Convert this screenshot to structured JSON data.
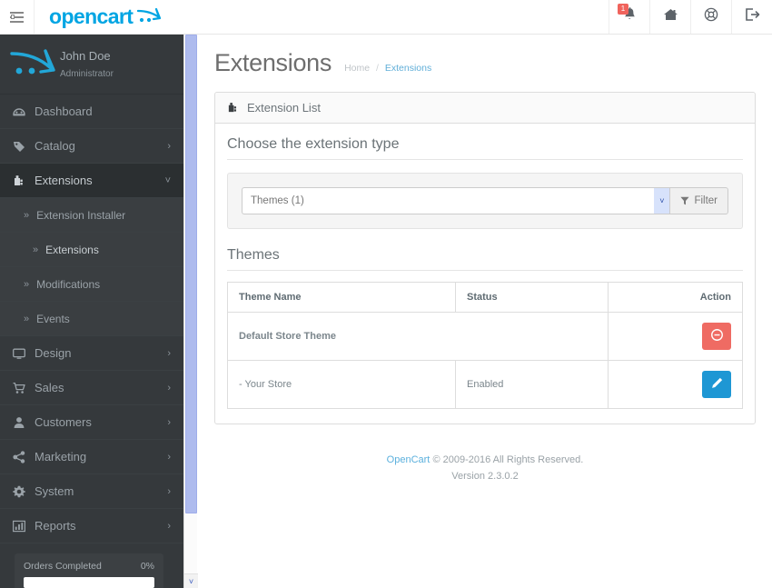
{
  "header": {
    "menu_toggle_name": "list-icon",
    "brand": "opencart",
    "notifications_count": "1",
    "buttons": [
      {
        "name": "notifications-button",
        "icon": "bell-icon"
      },
      {
        "name": "storefront-button",
        "icon": "home-icon"
      },
      {
        "name": "help-button",
        "icon": "lifering-icon"
      },
      {
        "name": "logout-button",
        "icon": "logout-icon"
      }
    ]
  },
  "sidebar": {
    "profile": {
      "name": "John Doe",
      "role": "Administrator"
    },
    "items": [
      {
        "label": "Dashboard",
        "icon": "dashboard-icon",
        "arrow": "",
        "active": false
      },
      {
        "label": "Catalog",
        "icon": "tag-icon",
        "arrow": "›",
        "active": false
      },
      {
        "label": "Extensions",
        "icon": "puzzle-icon",
        "arrow": "˅",
        "active": true
      }
    ],
    "sub_items": [
      {
        "label": "Extension Installer",
        "chevron": "»",
        "active": false
      },
      {
        "label": "Extensions",
        "chevron": "»",
        "active": true
      },
      {
        "label": "Modifications",
        "chevron": "»",
        "active": false
      },
      {
        "label": "Events",
        "chevron": "»",
        "active": false
      }
    ],
    "items_after": [
      {
        "label": "Design",
        "icon": "monitor-icon",
        "arrow": "›"
      },
      {
        "label": "Sales",
        "icon": "cart-icon",
        "arrow": "›"
      },
      {
        "label": "Customers",
        "icon": "user-icon",
        "arrow": "›"
      },
      {
        "label": "Marketing",
        "icon": "share-icon",
        "arrow": "›"
      },
      {
        "label": "System",
        "icon": "gear-icon",
        "arrow": "›"
      },
      {
        "label": "Reports",
        "icon": "barchart-icon",
        "arrow": "›"
      }
    ],
    "orders_widget": {
      "label": "Orders Completed",
      "percent": "0%"
    },
    "scrollbar": {
      "down_arrow": "˅"
    }
  },
  "page": {
    "title": "Extensions",
    "breadcrumb": {
      "home": "Home",
      "separator": "/",
      "current": "Extensions"
    }
  },
  "panel": {
    "heading": "Extension List",
    "heading_icon": "puzzle-icon",
    "legend": "Choose the extension type",
    "select_value": "Themes (1)",
    "select_arrow": "˅",
    "filter_label": "Filter",
    "filter_icon": "funnel-icon"
  },
  "table": {
    "title": "Themes",
    "columns": {
      "name": "Theme Name",
      "status": "Status",
      "action": "Action"
    },
    "rows": [
      {
        "name": "Default Store Theme",
        "status": "",
        "bold": true,
        "spans_status": true,
        "action_icon": "minus-circle-icon",
        "action_style": "danger"
      },
      {
        "name": "-  Your Store",
        "status": "Enabled",
        "bold": false,
        "spans_status": false,
        "action_icon": "pencil-icon",
        "action_style": "primary"
      }
    ]
  },
  "footer": {
    "link": "OpenCart",
    "copyright": "© 2009-2016 All Rights Reserved.",
    "version": "Version 2.3.0.2"
  },
  "colors": {
    "brand_blue": "#00a5e3",
    "sidebar_bg": "#35393c",
    "danger": "#ef6b63",
    "primary": "#1e97d4",
    "badge_red": "#f0635c",
    "link_blue": "#5bb0dd"
  }
}
